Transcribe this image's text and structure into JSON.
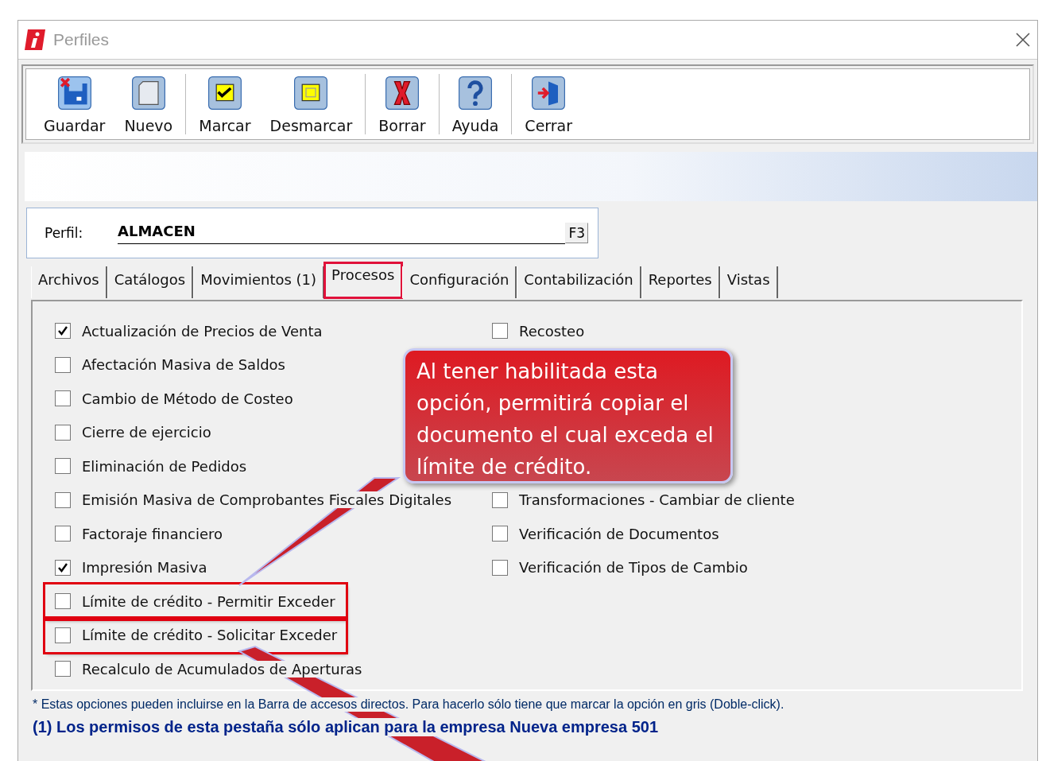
{
  "window": {
    "title": "Perfiles"
  },
  "toolbar": [
    {
      "label": "Guardar",
      "kind": "save"
    },
    {
      "label": "Nuevo",
      "kind": "new",
      "group_end": true
    },
    {
      "label": "Marcar",
      "kind": "mark"
    },
    {
      "label": "Desmarcar",
      "kind": "unmark",
      "group_end": true
    },
    {
      "label": "Borrar",
      "kind": "delete",
      "group_end": true
    },
    {
      "label": "Ayuda",
      "kind": "help",
      "group_end": true
    },
    {
      "label": "Cerrar",
      "kind": "exit"
    }
  ],
  "profile": {
    "label": "Perfil:",
    "value": "ALMACEN",
    "button": "F3"
  },
  "tabs": [
    {
      "label": "Archivos",
      "selected": false,
      "highlighted": false
    },
    {
      "label": "Catálogos",
      "selected": false,
      "highlighted": false
    },
    {
      "label": "Movimientos (1)",
      "selected": false,
      "highlighted": false
    },
    {
      "label": "Procesos",
      "selected": true,
      "highlighted": true
    },
    {
      "label": "Configuración",
      "selected": false,
      "highlighted": false
    },
    {
      "label": "Contabilización",
      "selected": false,
      "highlighted": false
    },
    {
      "label": "Reportes",
      "selected": false,
      "highlighted": false
    },
    {
      "label": "Vistas",
      "selected": false,
      "highlighted": false
    }
  ],
  "options_left": [
    {
      "label": "Actualización de Precios de Venta",
      "checked": true,
      "highlighted": false
    },
    {
      "label": "Afectación Masiva de Saldos",
      "checked": false,
      "highlighted": false
    },
    {
      "label": "Cambio de Método de Costeo",
      "checked": false,
      "highlighted": false
    },
    {
      "label": "Cierre de ejercicio",
      "checked": false,
      "highlighted": false
    },
    {
      "label": "Eliminación de Pedidos",
      "checked": false,
      "highlighted": false
    },
    {
      "label": "Emisión Masiva de Comprobantes Fiscales Digitales",
      "checked": false,
      "highlighted": false
    },
    {
      "label": "Factoraje financiero",
      "checked": false,
      "highlighted": false
    },
    {
      "label": "Impresión Masiva",
      "checked": true,
      "highlighted": false
    },
    {
      "label": "Límite de crédito - Permitir Exceder",
      "checked": false,
      "highlighted": true
    },
    {
      "label": "Límite de crédito - Solicitar Exceder",
      "checked": false,
      "highlighted": true
    },
    {
      "label": "Recalculo de Acumulados de Aperturas",
      "checked": false,
      "highlighted": false
    }
  ],
  "options_right_top": [
    {
      "label": "Recosteo",
      "checked": false
    }
  ],
  "callout": {
    "text": "Al tener habilitada esta opción, permitirá copiar el documento el cual exceda el límite de crédito."
  },
  "options_right_bottom": [
    {
      "label": "Transformaciones - Cambiar de cliente",
      "checked": false
    },
    {
      "label": "Verificación de Documentos",
      "checked": false
    },
    {
      "label": "Verificación de Tipos de Cambio",
      "checked": false
    }
  ],
  "footer": {
    "note": "* Estas opciones pueden incluirse en la Barra de accesos directos. Para hacerlo sólo tiene que marcar la opción en gris (Doble-click).",
    "permissions": "(1) Los permisos de esta pestaña sólo aplican para la empresa Nueva empresa 501"
  }
}
